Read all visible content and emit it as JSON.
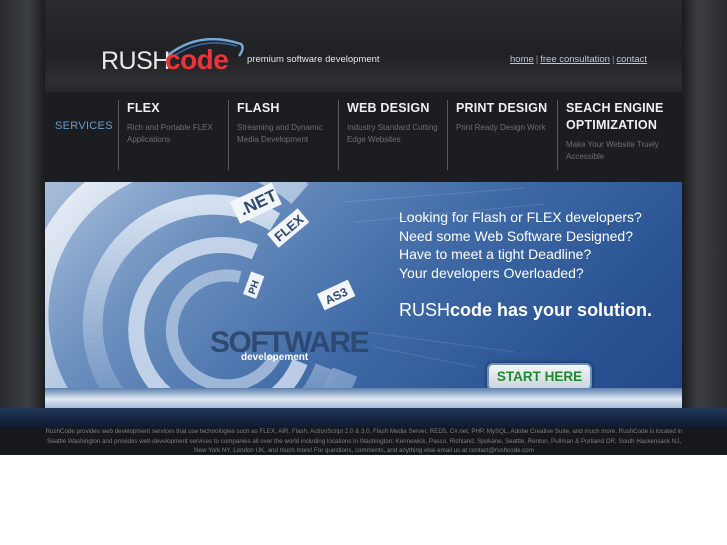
{
  "logo": {
    "rush": "RUSH",
    "code": "code",
    "tagline": "premium software development"
  },
  "toplinks": [
    {
      "label": "home"
    },
    {
      "label": "free consultation"
    },
    {
      "label": "contact"
    }
  ],
  "nav": {
    "label": "SERVICES",
    "items": [
      {
        "title": "FLEX",
        "desc": "Rich and Portable FLEX Applications"
      },
      {
        "title": "FLASH",
        "desc": "Streaming and Dynamic Media Development"
      },
      {
        "title": "WEB DESIGN",
        "desc": "Industry Standard Cutting Edge Websites"
      },
      {
        "title": "PRINT DESIGN",
        "desc": "Print Ready Design Work"
      },
      {
        "title": "SEACH ENGINE OPTIMIZATION",
        "desc": "Make Your Website Truely Accessible"
      }
    ]
  },
  "hero": {
    "graphic_labels": {
      "net": ".NET",
      "flex": "FLEX",
      "php": "PH",
      "as3": "AS3",
      "software": "SOFTWARE",
      "development": "developement"
    },
    "lines": [
      "Looking for Flash or FLEX developers?",
      "Need some Web Software Designed?",
      "Have to meet a tight Deadline?",
      "Your developers Overloaded?"
    ],
    "solution_rush": "RUSH",
    "solution_rest": "code has your solution.",
    "cta": "START HERE"
  },
  "footer": {
    "text": "RushCode provides web development services that use technologies such as FLEX, AIR, Flash, ActionScript 2.0 & 3.0, Flash Media Server, RED5, C#.net, PHP, MySQL, Adobe Creative Suite, and much more. RushCode is located in Seattle Washington and provides web development services to companies all over the world including locations in Washington: Kennewick, Pasco, Richland, Spokane, Seattle, Renton, Pullman & Portland OR, South Hackensack NJ, New York NY, London UK, and much more! For questions, comments, and anything else email us at contact@rushcode.com"
  },
  "colors": {
    "brand_red": "#e8353a",
    "services_blue": "#6f9ccc",
    "cta_green": "#1e8a2e"
  }
}
